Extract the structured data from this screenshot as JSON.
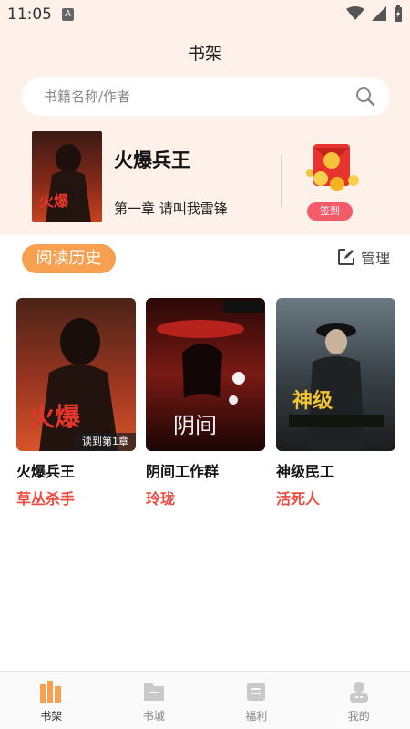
{
  "statusbar": {
    "time": "11:05",
    "notif_icon": "A"
  },
  "header": {
    "title": "书架"
  },
  "search": {
    "placeholder": "书籍名称/作者"
  },
  "current_reading": {
    "title": "火爆兵王",
    "chapter": "第一章 请叫我雷锋"
  },
  "signin": {
    "label": "签到"
  },
  "history": {
    "label": "阅读历史",
    "manage_label": "管理"
  },
  "books": [
    {
      "title": "火爆兵王",
      "author": "草丛杀手",
      "progress": "读到第1章"
    },
    {
      "title": "阴间工作群",
      "author": "玲珑"
    },
    {
      "title": "神级民工",
      "author": "活死人"
    }
  ],
  "nav": [
    {
      "label": "书架",
      "icon": "bookshelf-icon",
      "active": true
    },
    {
      "label": "书城",
      "icon": "bookstore-icon",
      "active": false
    },
    {
      "label": "福利",
      "icon": "welfare-icon",
      "active": false
    },
    {
      "label": "我的",
      "icon": "profile-icon",
      "active": false
    }
  ],
  "colors": {
    "accent": "#f7a04f",
    "author": "#f04a3e",
    "signin": "#f45b69",
    "header_bg": "#fdf1ea"
  }
}
